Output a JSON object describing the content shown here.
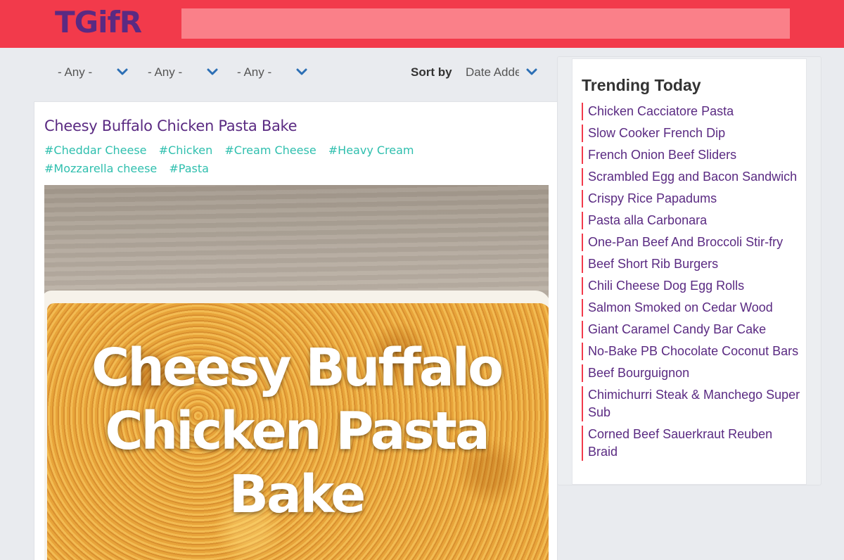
{
  "header": {
    "logo": "TGifR",
    "search_placeholder": ""
  },
  "filters": {
    "items": [
      {
        "label": "- Any -"
      },
      {
        "label": "- Any -"
      },
      {
        "label": "- Any -"
      }
    ],
    "sort_label": "Sort by",
    "sort_value": "Date Added"
  },
  "post": {
    "title": "Cheesy Buffalo Chicken Pasta Bake",
    "tags": [
      "#Cheddar Cheese",
      "#Chicken",
      "#Cream Cheese",
      "#Heavy Cream",
      "#Mozzarella cheese",
      "#Pasta"
    ],
    "image_overlay": [
      "Cheesy Buffalo",
      "Chicken Pasta",
      "Bake"
    ]
  },
  "sidebar": {
    "title": "Trending Today",
    "items": [
      "Chicken Cacciatore Pasta",
      "Slow Cooker French Dip",
      "French Onion Beef Sliders",
      "Scrambled Egg and Bacon Sandwich",
      "Crispy Rice Papadums",
      "Pasta alla Carbonara",
      "One-Pan Beef And Broccoli Stir-fry",
      "Beef Short Rib Burgers",
      "Chili Cheese Dog Egg Rolls",
      "Salmon Smoked on Cedar Wood",
      "Giant Caramel Candy Bar Cake",
      "No-Bake PB Chocolate Coconut Bars",
      "Beef Bourguignon",
      "Chimichurri Steak & Manchego Super Sub",
      "Corned Beef Sauerkraut Reuben Braid"
    ]
  },
  "colors": {
    "header_bg": "#f23a4b",
    "search_bg": "#fa8089",
    "brand_purple": "#5a2a82",
    "tag_teal": "#2fbfae",
    "chevron_blue": "#2c6fb5"
  },
  "icons": {
    "filter_chevron": "chevron-down-icon"
  }
}
